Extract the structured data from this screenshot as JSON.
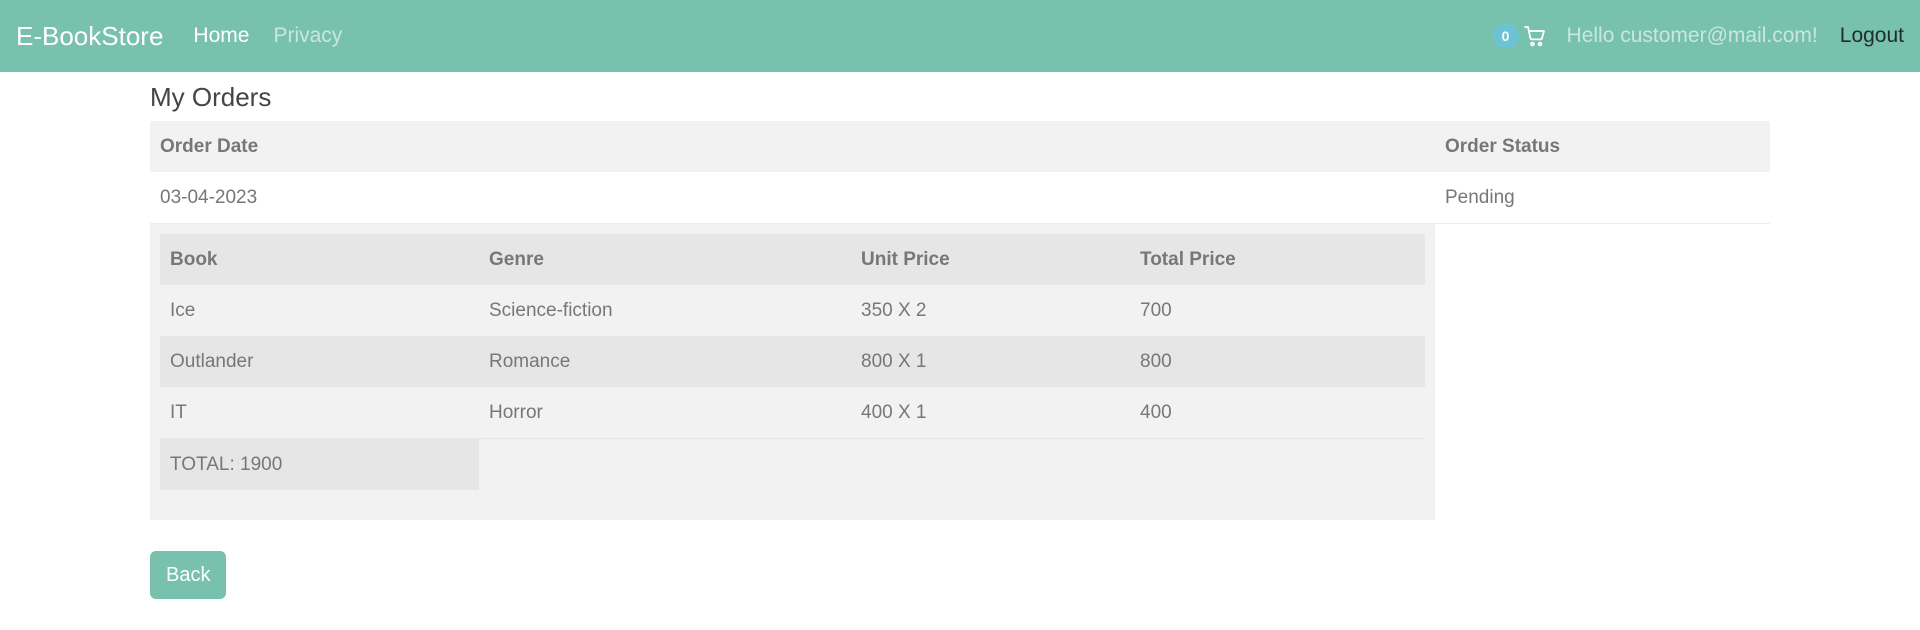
{
  "navbar": {
    "brand": "E-BookStore",
    "home": "Home",
    "privacy": "Privacy",
    "cart_count": "0",
    "greeting": "Hello customer@mail.com!",
    "logout": "Logout"
  },
  "page": {
    "title": "My Orders"
  },
  "orders_table": {
    "headers": {
      "date": "Order Date",
      "status": "Order Status"
    },
    "order": {
      "date": "03-04-2023",
      "status": "Pending"
    }
  },
  "items_table": {
    "headers": {
      "book": "Book",
      "genre": "Genre",
      "unit_price": "Unit Price",
      "total_price": "Total Price"
    },
    "rows": [
      {
        "book": "Ice",
        "genre": "Science-fiction",
        "unit_price": "350 X 2",
        "total_price": "700"
      },
      {
        "book": "Outlander",
        "genre": "Romance",
        "unit_price": "800 X 1",
        "total_price": "800"
      },
      {
        "book": "IT",
        "genre": "Horror",
        "unit_price": "400 X 1",
        "total_price": "400"
      }
    ],
    "total": "TOTAL: 1900"
  },
  "actions": {
    "back": "Back"
  },
  "colors": {
    "primary": "#78c2ad",
    "badge": "#6cc3d5"
  },
  "icons": {
    "cart": "cart-icon"
  }
}
